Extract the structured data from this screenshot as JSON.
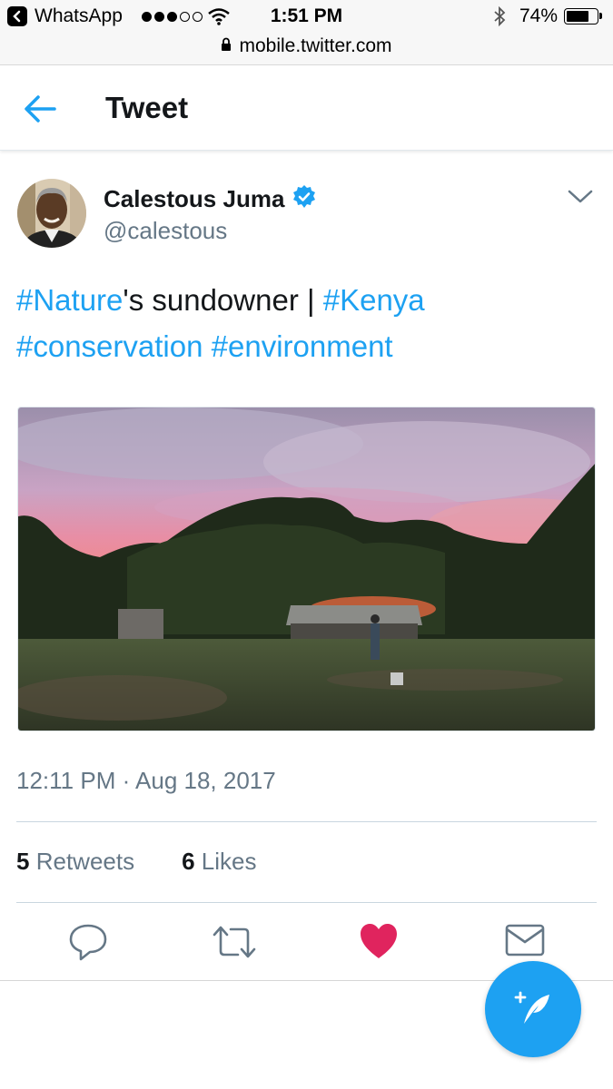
{
  "status_bar": {
    "back_app": "WhatsApp",
    "time": "1:51 PM",
    "battery": "74%",
    "battery_level": 0.74,
    "url": "mobile.twitter.com"
  },
  "header": {
    "title": "Tweet"
  },
  "tweet": {
    "display_name": "Calestous Juma",
    "handle": "@calestous",
    "verified": true,
    "text": {
      "tag1": "#Nature",
      "plain1": "'s sundowner | ",
      "tag2": "#Kenya",
      "tag3": "#conservation",
      "tag4": "#environment"
    },
    "timestamp": "12:11 PM · Aug 18, 2017",
    "retweets": {
      "count": "5",
      "label": "Retweets"
    },
    "likes": {
      "count": "6",
      "label": "Likes"
    },
    "liked": true
  },
  "colors": {
    "accent": "#1da1f2",
    "like": "#e0245e",
    "secondary_text": "#657786"
  }
}
